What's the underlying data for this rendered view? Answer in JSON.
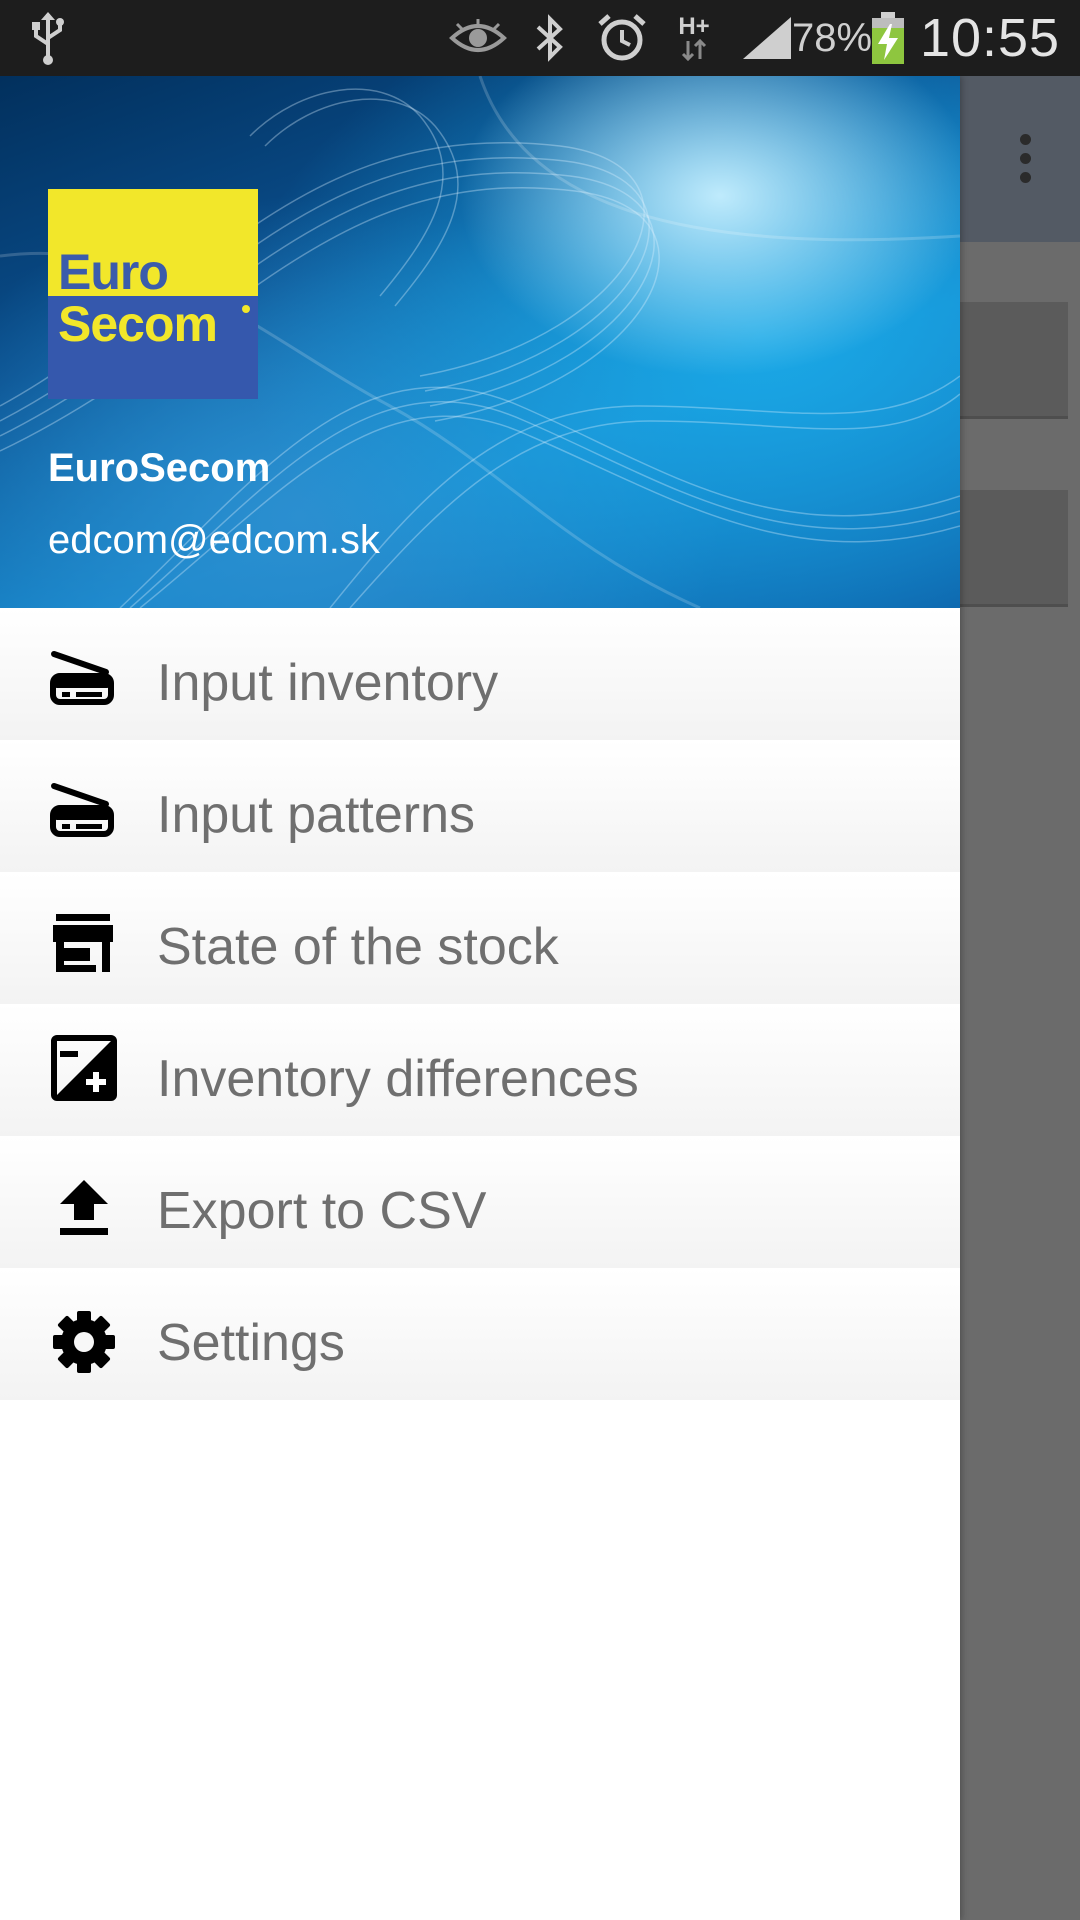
{
  "status_bar": {
    "icons": [
      "usb-icon",
      "eye-icon",
      "bluetooth-icon",
      "alarm-icon",
      "hplus-network-icon",
      "signal-icon",
      "battery-charging-icon"
    ],
    "network_label": "H+",
    "battery": "78%",
    "time": "10:55"
  },
  "drawer": {
    "header": {
      "logo": {
        "line1": "Euro",
        "line2": "Secom",
        "colors": {
          "top": "#f2e72a",
          "bottom": "#3558ad"
        }
      },
      "account_name": "EuroSecom",
      "account_email": "edcom@edcom.sk"
    },
    "items": [
      {
        "label": "Input inventory",
        "icon": "scanner-icon"
      },
      {
        "label": "Input patterns",
        "icon": "scanner-icon"
      },
      {
        "label": "State of the stock",
        "icon": "store-icon"
      },
      {
        "label": "Inventory differences",
        "icon": "exposure-plus-icon"
      },
      {
        "label": "Export to CSV",
        "icon": "upload-icon"
      },
      {
        "label": "Settings",
        "icon": "gear-icon"
      }
    ]
  },
  "background_app": {
    "icons": [
      "overflow-menu-icon"
    ]
  },
  "colors": {
    "label_text": "#6f6f6f",
    "status_bar": "#1d1d1d",
    "scrim": "#686868"
  }
}
